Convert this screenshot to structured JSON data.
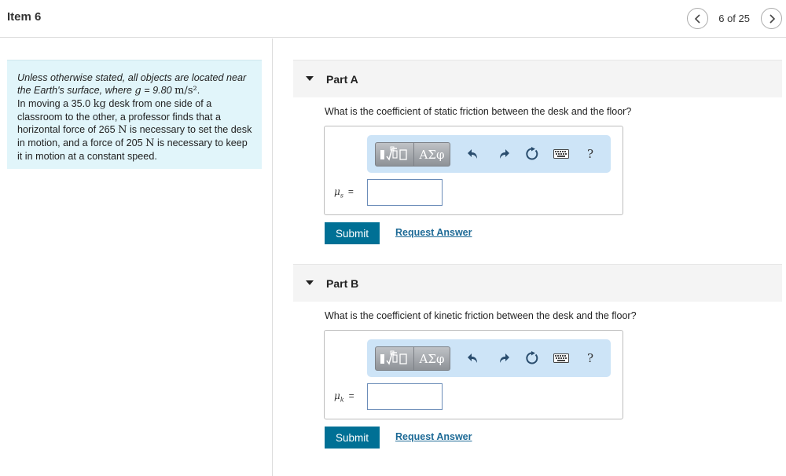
{
  "header": {
    "title": "Item 6",
    "counter": "6 of 25"
  },
  "problem": {
    "intro_italic": "Unless otherwise stated, all objects are located near the Earth's surface, where",
    "g_symbol": "g",
    "g_value": "= 9.80",
    "g_unit": "m/s²",
    "g_end": ".",
    "text_1": "In moving a 35.0",
    "unit_kg": "kg",
    "text_2": "desk from one side of a classroom to the other, a professor finds that a horizontal force of 265",
    "unit_N1": "N",
    "text_3": "is necessary to set the desk in motion, and a force of 205",
    "unit_N2": "N",
    "text_4": "is necessary to keep it in motion at a constant speed."
  },
  "parts": [
    {
      "label": "Part A",
      "question": "What is the coefficient of static friction between the desk and the floor?",
      "var_symbol": "μ",
      "var_sub": "s",
      "equals": "=",
      "input_value": "",
      "submit_label": "Submit",
      "request_label": "Request Answer"
    },
    {
      "label": "Part B",
      "question": "What is the coefficient of kinetic friction between the desk and the floor?",
      "var_symbol": "μ",
      "var_sub": "k",
      "equals": "=",
      "input_value": "",
      "submit_label": "Submit",
      "request_label": "Request Answer"
    }
  ],
  "toolbar": {
    "greek_label": "ΑΣφ",
    "help_label": "?",
    "icons": [
      "templates-icon",
      "undo-icon",
      "redo-icon",
      "reset-icon",
      "keyboard-icon",
      "help-icon"
    ]
  },
  "colors": {
    "submit_bg": "#007095",
    "link": "#1d6a96",
    "info_bg": "#e1f5fa",
    "toolbar_bg": "#cde4f7"
  }
}
